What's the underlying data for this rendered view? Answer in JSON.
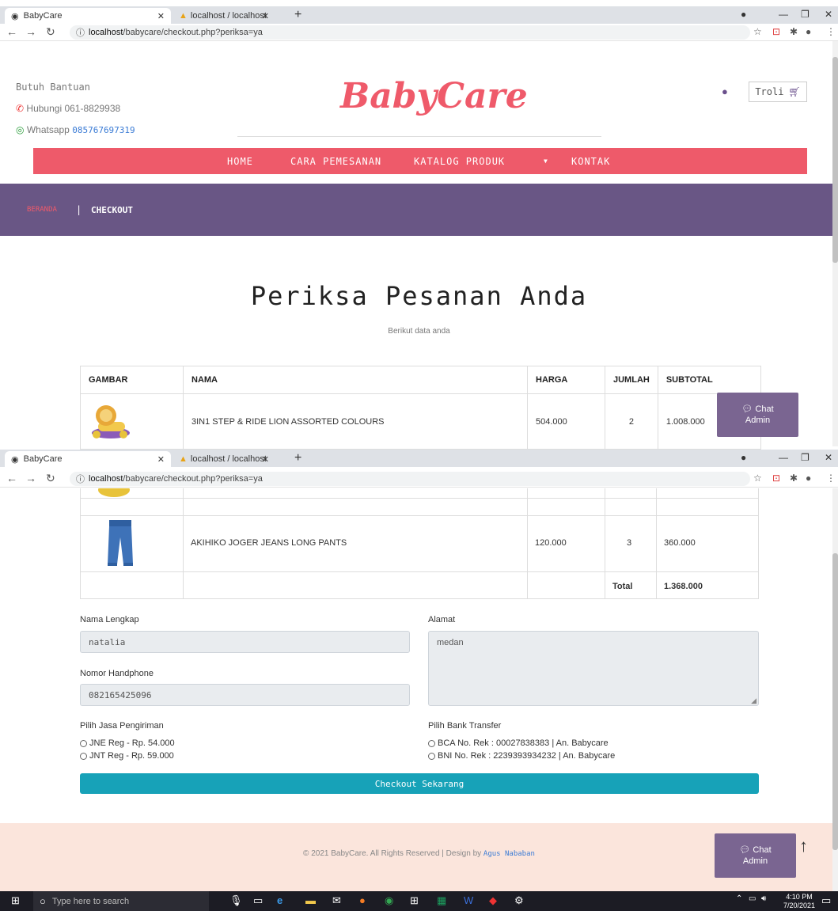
{
  "browser": {
    "tab1_title": "BabyCare",
    "tab2_title": "localhost / localhost / babycare /",
    "url_host": "localhost",
    "url_path": "/babycare/checkout.php?periksa=ya"
  },
  "header": {
    "help_title": "Butuh Bantuan",
    "phone": "Hubungi 061-8829938",
    "whatsapp_label": "Whatsapp",
    "whatsapp_number": "085767697319",
    "logo": "BabyCare",
    "cart_label": "Troli"
  },
  "nav": {
    "items": [
      "HOME",
      "CARA PEMESANAN",
      "KATALOG PRODUK",
      "KONTAK"
    ]
  },
  "breadcrumb": {
    "home": "BERANDA",
    "sep": "|",
    "current": "CHECKOUT"
  },
  "main": {
    "title": "Periksa Pesanan Anda",
    "subtitle": "Berikut data anda"
  },
  "table": {
    "headers": [
      "GAMBAR",
      "NAMA",
      "HARGA",
      "JUMLAH",
      "SUBTOTAL"
    ],
    "rows": [
      {
        "name": "3IN1 STEP & RIDE LION ASSORTED COLOURS",
        "price": "504.000",
        "qty": "2",
        "subtotal": "1.008.000"
      },
      {
        "name": "AKIHIKO JOGER JEANS LONG PANTS",
        "price": "120.000",
        "qty": "3",
        "subtotal": "360.000"
      }
    ],
    "total_label": "Total",
    "total_value": "1.368.000"
  },
  "chat": {
    "line1": "Chat",
    "line2": "Admin"
  },
  "form": {
    "name_label": "Nama Lengkap",
    "name_value": "natalia",
    "address_label": "Alamat",
    "address_value": "medan",
    "phone_label": "Nomor Handphone",
    "phone_value": "082165425096",
    "shipping_label": "Pilih Jasa Pengiriman",
    "shipping_options": [
      "JNE Reg - Rp. 54.000",
      "JNT Reg - Rp. 59.000"
    ],
    "bank_label": "Pilih Bank Transfer",
    "bank_options": [
      "BCA No. Rek : 00027838383 | An. Babycare",
      "BNI No. Rek : 2239393934232 | An. Babycare"
    ],
    "submit_label": "Checkout Sekarang"
  },
  "footer": {
    "text": "© 2021 BabyCare. All Rights Reserved | Design by",
    "author": "Agus Nababan"
  },
  "taskbar": {
    "search_placeholder": "Type here to search",
    "time": "4:10 PM",
    "date": "7/20/2021"
  },
  "colors": {
    "brand": "#ef5a6a",
    "banner": "#695685",
    "chat": "#7a6591",
    "button": "#17a2b8",
    "footer": "#fbe5dc"
  }
}
